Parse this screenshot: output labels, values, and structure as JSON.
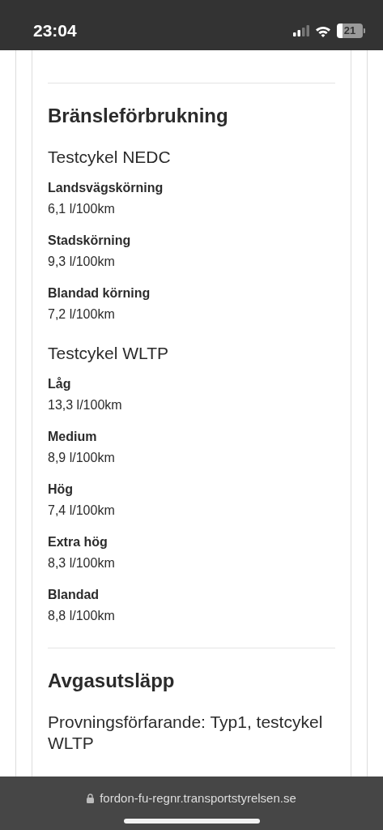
{
  "status_bar": {
    "time": "23:04",
    "battery": "21"
  },
  "sections": [
    {
      "title": "Bränsleförbrukning",
      "groups": [
        {
          "title": "Testcykel NEDC",
          "items": [
            {
              "label": "Landsvägskörning",
              "value": "6,1 l/100km"
            },
            {
              "label": "Stadskörning",
              "value": "9,3 l/100km"
            },
            {
              "label": "Blandad körning",
              "value": "7,2 l/100km"
            }
          ]
        },
        {
          "title": "Testcykel WLTP",
          "items": [
            {
              "label": "Låg",
              "value": "13,3 l/100km"
            },
            {
              "label": "Medium",
              "value": "8,9 l/100km"
            },
            {
              "label": "Hög",
              "value": "7,4 l/100km"
            },
            {
              "label": "Extra hög",
              "value": "8,3 l/100km"
            },
            {
              "label": "Blandad",
              "value": "8,8 l/100km"
            }
          ]
        }
      ]
    },
    {
      "title": "Avgasutsläpp",
      "groups": [
        {
          "title": "Provningsförfarande: Typ1, testcykel WLTP"
        }
      ]
    }
  ],
  "address_bar": {
    "url": "fordon-fu-regnr.transportstyrelsen.se"
  }
}
